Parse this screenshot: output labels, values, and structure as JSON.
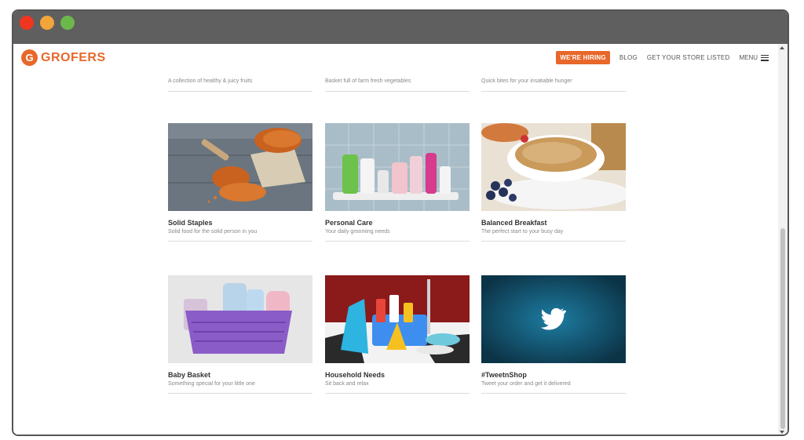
{
  "brand": {
    "name": "GROFERS",
    "mark": "G"
  },
  "nav": {
    "hiring": "WE'RE HIRING",
    "blog": "BLOG",
    "store": "GET YOUR STORE LISTED",
    "menu": "MENU"
  },
  "top_row": [
    {
      "subtitle": "A collection of healthy & juicy fruits"
    },
    {
      "subtitle": "Basket full of farm fresh vegetables"
    },
    {
      "subtitle": "Quick bites for your insatiable hunger"
    }
  ],
  "categories": [
    {
      "title": "Solid Staples",
      "subtitle": "Solid food for the solid person in you"
    },
    {
      "title": "Personal Care",
      "subtitle": "Your daily grooming needs"
    },
    {
      "title": "Balanced Breakfast",
      "subtitle": "The perfect start to your busy day"
    },
    {
      "title": "Baby Basket",
      "subtitle": "Something special for your little one"
    },
    {
      "title": "Household Needs",
      "subtitle": "Sit back and relax"
    },
    {
      "title": "#TweetnShop",
      "subtitle": "Tweet your order and get it delivered"
    }
  ],
  "colors": {
    "accent": "#e8672a",
    "titlebar": "#5f5f5f",
    "twitter_bg": "#1a6e8e"
  },
  "icons": [
    "twitter-icon",
    "hamburger-icon"
  ]
}
